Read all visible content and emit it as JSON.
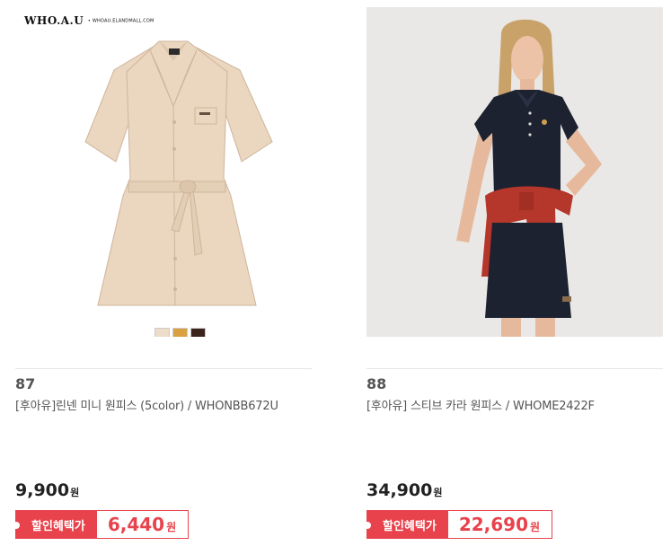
{
  "products": [
    {
      "brand_logo": "WHO.A.U",
      "brand_url": "• WHOAU.ELANDMALL.COM",
      "number": "87",
      "name": "[후아유]린넨 미니 원피스 (5color) / WHONBB672U",
      "price": "9,900",
      "price_unit": "원",
      "discount_label": "할인혜택가",
      "discount_price": "6,440",
      "discount_unit": "원",
      "swatch_colors": [
        "#eddcc8",
        "#d9a141",
        "#3b241b"
      ]
    },
    {
      "number": "88",
      "name": "[후아유] 스티브 카라 원피스 / WHOME2422F",
      "price": "34,900",
      "price_unit": "원",
      "discount_label": "할인혜택가",
      "discount_price": "22,690",
      "discount_unit": "원"
    }
  ],
  "colors": {
    "accent": "#e8434c",
    "dress_beige": "#ebd6bf",
    "polo_navy": "#1c2230",
    "sweater_red": "#b5362a"
  }
}
